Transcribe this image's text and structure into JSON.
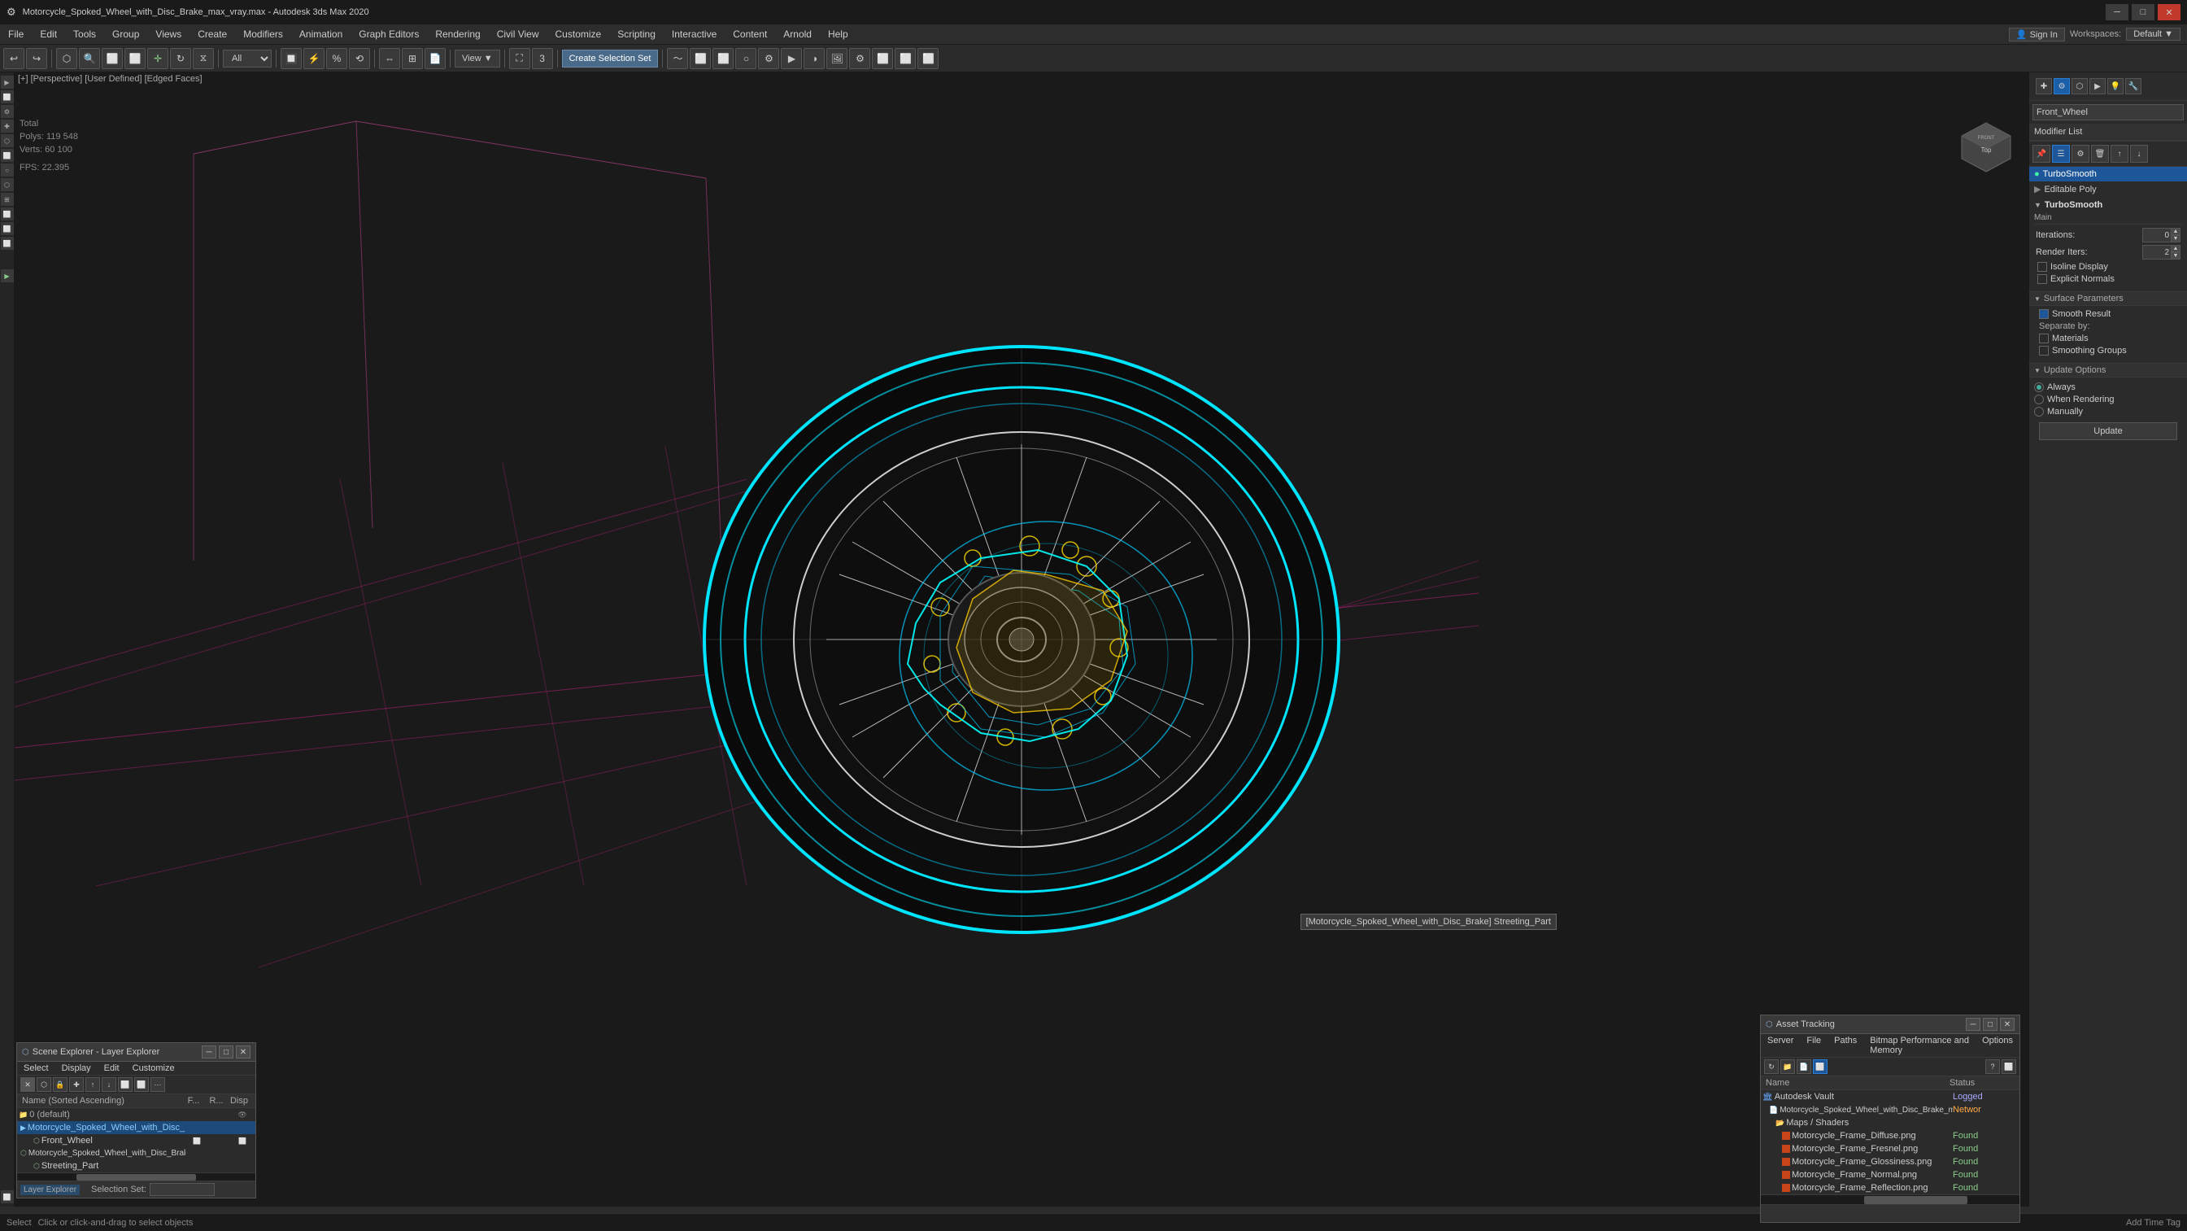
{
  "title_bar": {
    "title": "Motorcycle_Spoked_Wheel_with_Disc_Brake_max_vray.max - Autodesk 3ds Max 2020",
    "minimize": "─",
    "maximize": "□",
    "close": "✕"
  },
  "menu_bar": {
    "items": [
      "File",
      "Edit",
      "Tools",
      "Group",
      "Views",
      "Create",
      "Modifiers",
      "Animation",
      "Graph Editors",
      "Rendering",
      "Civil View",
      "Customize",
      "Scripting",
      "Interactive",
      "Content",
      "Arnold",
      "Help"
    ]
  },
  "toolbar": {
    "view_dropdown": "All",
    "create_selection_set": "Create Selection Set",
    "view_btn": "View"
  },
  "viewport": {
    "label": "[+] [Perspective] [User Defined] [Edged Faces]",
    "stats_total": "Total",
    "stats_polys": "Polys:  119 548",
    "stats_verts": "Verts:   60 100",
    "fps_label": "FPS:",
    "fps_value": "22.395",
    "tooltip": "[Motorcycle_Spoked_Wheel_with_Disc_Brake] Streeting_Part"
  },
  "right_panel": {
    "object_name": "Front_Wheel",
    "modifier_list_label": "Modifier List",
    "modifiers": [
      {
        "name": "TurboSmooth",
        "active": true
      },
      {
        "name": "Editable Poly",
        "active": false
      }
    ],
    "turbosm": {
      "header": "TurboSmooth",
      "sub": "Main",
      "iterations_label": "Iterations:",
      "iterations_value": "0",
      "render_iters_label": "Render Iters:",
      "render_iters_value": "2",
      "isoline_label": "Isoline Display",
      "explicit_label": "Explicit Normals"
    },
    "surface_params": {
      "header": "Surface Parameters",
      "smooth_result": "Smooth Result",
      "separate_by": "Separate by:",
      "materials": "Materials",
      "smoothing_groups": "Smoothing Groups"
    },
    "update_options": {
      "header": "Update Options",
      "always": "Always",
      "when_rendering": "When Rendering",
      "manually": "Manually",
      "update_btn": "Update"
    }
  },
  "scene_explorer": {
    "title": "Scene Explorer - Layer Explorer",
    "menus": [
      "Select",
      "Display",
      "Edit",
      "Customize"
    ],
    "columns": {
      "name": "Name (Sorted Ascending)",
      "f": "F...",
      "r": "R...",
      "disp": "Disp"
    },
    "rows": [
      {
        "name": "0 (default)",
        "indent": 0,
        "type": "layer",
        "icons": ""
      },
      {
        "name": "Motorcycle_Spoked_Wheel_with_Disc_Brake",
        "indent": 1,
        "type": "object"
      },
      {
        "name": "Front_Wheel",
        "indent": 2,
        "type": "object",
        "selected": false
      },
      {
        "name": "Motorcycle_Spoked_Wheel_with_Disc_Brake",
        "indent": 2,
        "type": "object"
      },
      {
        "name": "Streeting_Part",
        "indent": 2,
        "type": "object"
      }
    ],
    "footer_layer": "Layer Explorer",
    "footer_sel": "Selection Set:"
  },
  "asset_tracking": {
    "title": "Asset Tracking",
    "menus": [
      "Server",
      "File",
      "Paths",
      "Bitmap Performance and Memory",
      "Options"
    ],
    "columns": {
      "name": "Name",
      "status": "Status"
    },
    "rows": [
      {
        "name": "Autodesk Vault",
        "indent": 0,
        "type": "vault",
        "status": "Logged"
      },
      {
        "name": "Motorcycle_Spoked_Wheel_with_Disc_Brake_max_vray.max",
        "indent": 1,
        "type": "file",
        "status": "Networ"
      },
      {
        "name": "Maps / Shaders",
        "indent": 2,
        "type": "maps",
        "status": ""
      },
      {
        "name": "Motorcycle_Frame_Diffuse.png",
        "indent": 3,
        "type": "img",
        "status": "Found"
      },
      {
        "name": "Motorcycle_Frame_Fresnel.png",
        "indent": 3,
        "type": "img",
        "status": "Found"
      },
      {
        "name": "Motorcycle_Frame_Glossiness.png",
        "indent": 3,
        "type": "img",
        "status": "Found"
      },
      {
        "name": "Motorcycle_Frame_Normal.png",
        "indent": 3,
        "type": "img",
        "status": "Found"
      },
      {
        "name": "Motorcycle_Frame_Reflection.png",
        "indent": 3,
        "type": "img",
        "status": "Found"
      }
    ]
  }
}
